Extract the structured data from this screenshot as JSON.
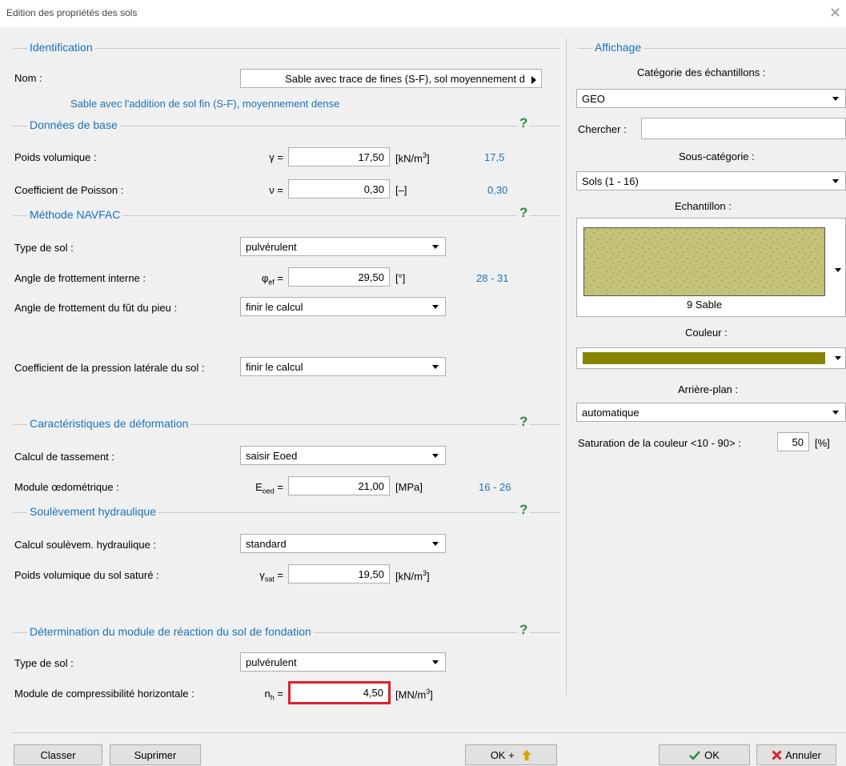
{
  "window": {
    "title": "Edition des propriétés des sols",
    "close_label": "✕"
  },
  "identification": {
    "section_title": "Identification",
    "nom_label": "Nom :",
    "nom_value": "Sable avec trace de fines (S-F), sol moyennement d",
    "description": "Sable avec l'addition de sol fin (S-F), moyennement dense"
  },
  "donnees_base": {
    "section_title": "Données de base",
    "help": "?",
    "poids_label": "Poids volumique :",
    "poids_symbol": "γ =",
    "poids_value": "17,50",
    "poids_unit_base": "[kN/m",
    "poids_unit_sup": "3",
    "poids_unit_end": "]",
    "poids_hint": "17,5",
    "poisson_label": "Coefficient de Poisson :",
    "poisson_symbol": "ν =",
    "poisson_value": "0,30",
    "poisson_unit": "[–]",
    "poisson_hint": "0,30"
  },
  "navfac": {
    "section_title": "Méthode NAVFAC",
    "help": "?",
    "type_label": "Type de sol :",
    "type_value": "pulvérulent",
    "angle_label": "Angle de frottement interne :",
    "angle_symbol": "φ",
    "angle_symbol_sub": "ef",
    "angle_symbol_eq": " =",
    "angle_value": "29,50",
    "angle_unit": "[°]",
    "angle_hint": "28 - 31",
    "fut_label": "Angle de frottement du fût du pieu :",
    "fut_value": "finir le calcul",
    "lat_label": "Coefficient de la pression latérale du sol :",
    "lat_value": "finir le calcul"
  },
  "deformation": {
    "section_title": "Caractéristiques de déformation",
    "help": "?",
    "tass_label": "Calcul de tassement :",
    "tass_value": "saisir Eoed",
    "mod_label": "Module œdométrique :",
    "mod_symbol": "E",
    "mod_symbol_sub": "oed",
    "mod_symbol_eq": " =",
    "mod_value": "21,00",
    "mod_unit": "[MPa]",
    "mod_hint": "16 - 26"
  },
  "soulevement": {
    "section_title": "Soulèvement hydraulique",
    "help": "?",
    "calc_label": "Calcul soulèvem. hydraulique :",
    "calc_value": "standard",
    "sat_label": "Poids volumique du sol saturé :",
    "sat_symbol": "γ",
    "sat_symbol_sub": "sat",
    "sat_symbol_eq": " =",
    "sat_value": "19,50",
    "sat_unit_base": "[kN/m",
    "sat_unit_sup": "3",
    "sat_unit_end": "]"
  },
  "reaction": {
    "section_title": "Détermination du module de réaction du sol de fondation",
    "help": "?",
    "type_label": "Type de sol :",
    "type_value": "pulvérulent",
    "comp_label": "Module de compressibilité horizontale :",
    "comp_symbol": "n",
    "comp_symbol_sub": "h",
    "comp_symbol_eq": " =",
    "comp_value": "4,50",
    "comp_unit_base": "[MN/m",
    "comp_unit_sup": "3",
    "comp_unit_end": "]",
    "highlight_color": "#e0202a"
  },
  "affichage": {
    "section_title": "Affichage",
    "categorie_label": "Catégorie des échantillons :",
    "categorie_value": "GEO",
    "chercher_label": "Chercher :",
    "chercher_value": "",
    "souscat_label": "Sous-catégorie :",
    "souscat_value": "Sols (1 - 16)",
    "echantillon_label": "Echantillon :",
    "echantillon_caption": "9 Sable",
    "sample_color": "#c5c27a",
    "couleur_label": "Couleur :",
    "couleur_swatch": "#858400",
    "arriere_label": "Arrière-plan :",
    "arriere_value": "automatique",
    "saturation_label": "Saturation de la couleur <10 - 90> :",
    "saturation_value": "50",
    "saturation_unit": "[%]"
  },
  "footer": {
    "classer": "Classer",
    "suprimer": "Suprimer",
    "ok_plus": "OK +",
    "ok": "OK",
    "annuler": "Annuler"
  }
}
